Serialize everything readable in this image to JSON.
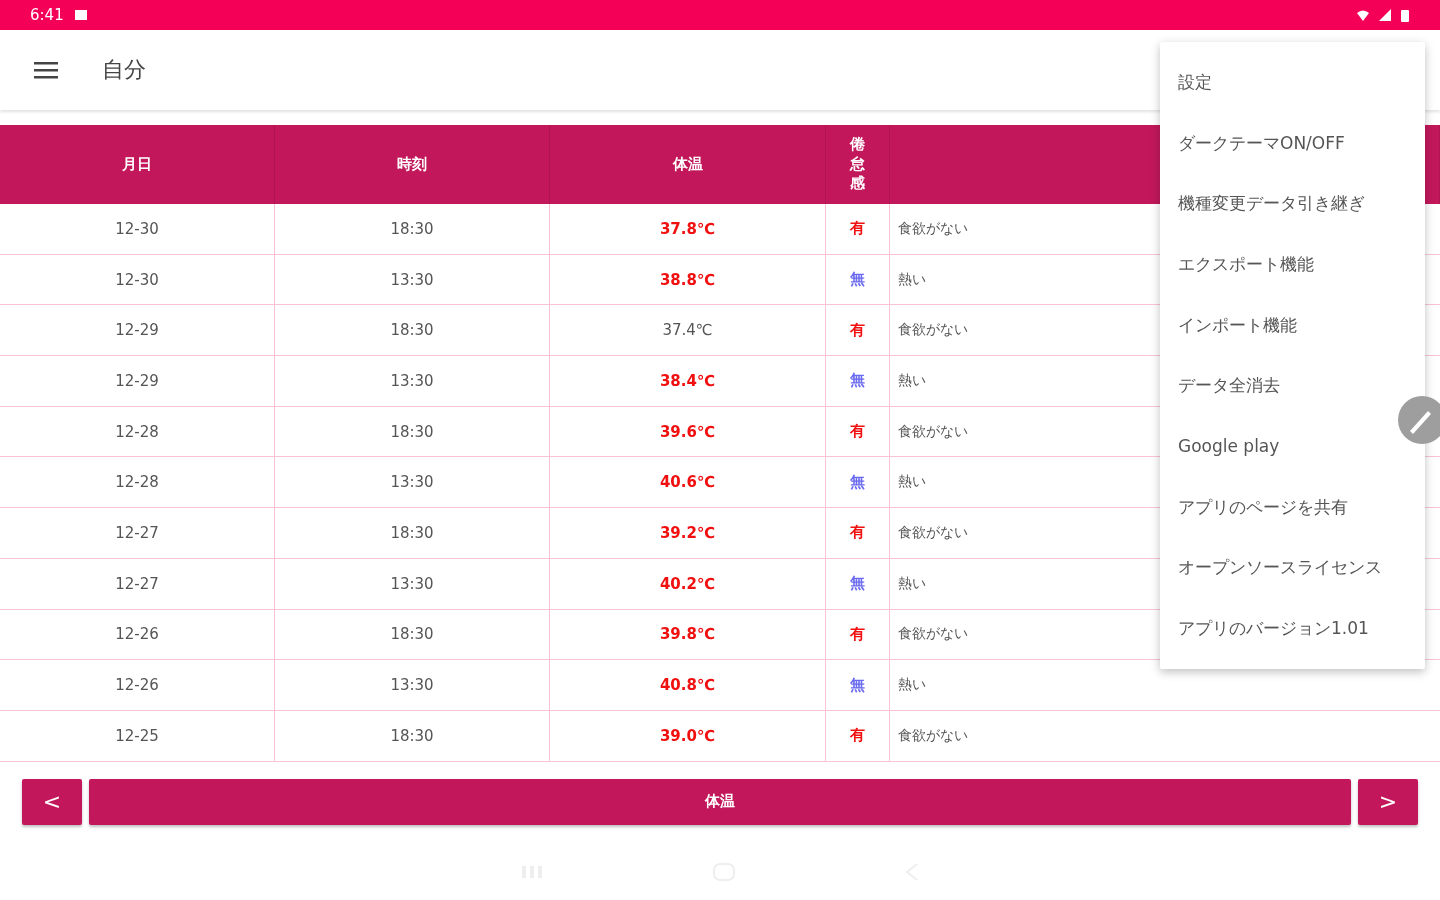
{
  "status_bar": {
    "time": "6:41"
  },
  "app_bar": {
    "title": "自分"
  },
  "table": {
    "columns": [
      "月日",
      "時刻",
      "体温",
      "倦怠感"
    ],
    "rows": [
      {
        "date": "12-30",
        "time": "18:30",
        "temperature": "37.8℃",
        "fever": true,
        "fatigue": "有",
        "fatigue_present": true,
        "symptom": "食欲がない"
      },
      {
        "date": "12-30",
        "time": "13:30",
        "temperature": "38.8℃",
        "fever": true,
        "fatigue": "無",
        "fatigue_present": false,
        "symptom": "熱い"
      },
      {
        "date": "12-29",
        "time": "18:30",
        "temperature": "37.4℃",
        "fever": false,
        "fatigue": "有",
        "fatigue_present": true,
        "symptom": "食欲がない"
      },
      {
        "date": "12-29",
        "time": "13:30",
        "temperature": "38.4℃",
        "fever": true,
        "fatigue": "無",
        "fatigue_present": false,
        "symptom": "熱い"
      },
      {
        "date": "12-28",
        "time": "18:30",
        "temperature": "39.6℃",
        "fever": true,
        "fatigue": "有",
        "fatigue_present": true,
        "symptom": "食欲がない"
      },
      {
        "date": "12-28",
        "time": "13:30",
        "temperature": "40.6℃",
        "fever": true,
        "fatigue": "無",
        "fatigue_present": false,
        "symptom": "熱い"
      },
      {
        "date": "12-27",
        "time": "18:30",
        "temperature": "39.2℃",
        "fever": true,
        "fatigue": "有",
        "fatigue_present": true,
        "symptom": "食欲がない"
      },
      {
        "date": "12-27",
        "time": "13:30",
        "temperature": "40.2℃",
        "fever": true,
        "fatigue": "無",
        "fatigue_present": false,
        "symptom": "熱い"
      },
      {
        "date": "12-26",
        "time": "18:30",
        "temperature": "39.8℃",
        "fever": true,
        "fatigue": "有",
        "fatigue_present": true,
        "symptom": "食欲がない"
      },
      {
        "date": "12-26",
        "time": "13:30",
        "temperature": "40.8℃",
        "fever": true,
        "fatigue": "無",
        "fatigue_present": false,
        "symptom": "熱い"
      },
      {
        "date": "12-25",
        "time": "18:30",
        "temperature": "39.0℃",
        "fever": true,
        "fatigue": "有",
        "fatigue_present": true,
        "symptom": "食欲がない"
      }
    ]
  },
  "pager": {
    "previous": "<",
    "label": "体温",
    "next": ">"
  },
  "menu": {
    "items": [
      "設定",
      "ダークテーマON/OFF",
      "機種変更データ引き継ぎ",
      "エクスポート機能",
      "インポート機能",
      "データ全消去",
      "Google play",
      "アプリのページを共有",
      "オープンソースライセンス",
      "アプリのバージョン1.01"
    ]
  }
}
